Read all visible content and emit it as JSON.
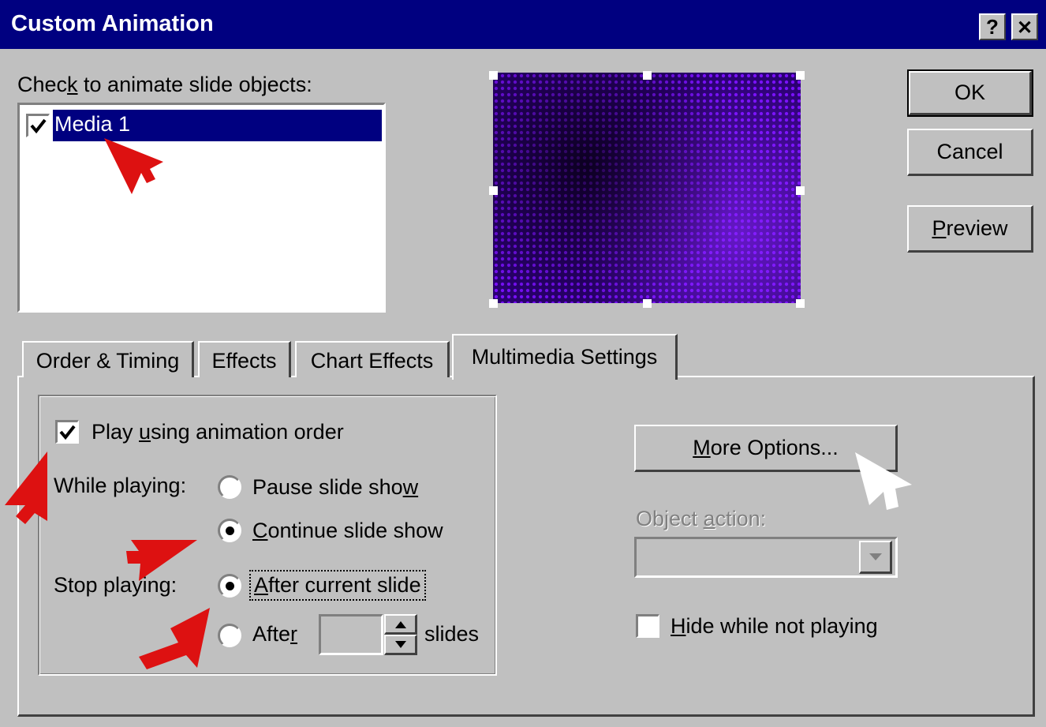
{
  "window": {
    "title": "Custom Animation",
    "help_label": "?",
    "close_label": "✕"
  },
  "objects": {
    "label_pre": "Chec",
    "label_accel": "k",
    "label_post": " to animate slide objects:",
    "items": [
      {
        "label": "Media 1",
        "checked": true
      }
    ]
  },
  "buttons": {
    "ok": "OK",
    "cancel": "Cancel",
    "preview_accel": "P",
    "preview_rest": "review"
  },
  "tabs": [
    {
      "label": "Order & Timing"
    },
    {
      "label": "Effects"
    },
    {
      "label": "Chart Effects"
    },
    {
      "label": "Multimedia Settings",
      "active": true
    }
  ],
  "multimedia": {
    "play_pre": "Play ",
    "play_accel": "u",
    "play_post": "sing animation order",
    "play_checked": true,
    "while_playing_label": "While playing:",
    "pause_pre": "Pause slide sho",
    "pause_accel": "w",
    "continue_accel": "C",
    "continue_rest": "ontinue slide show",
    "while_selected": "continue",
    "stop_playing_label": "Stop playing:",
    "after_current_accel": "A",
    "after_current_rest": "fter current slide",
    "after_n_pre": "Afte",
    "after_n_accel": "r",
    "after_n_value": "",
    "slides_label": "slides",
    "stop_selected": "after_current",
    "more_options_accel": "M",
    "more_options_rest": "ore Options...",
    "object_action_pre": "Object ",
    "object_action_accel": "a",
    "object_action_post": "ction:",
    "object_action_value": "",
    "hide_accel": "H",
    "hide_rest": "ide while not playing",
    "hide_checked": false
  },
  "colors": {
    "titlebar": "#000080",
    "selection": "#000080",
    "face": "#c0c0c0",
    "arrow_red": "#dd1111"
  },
  "icons": [
    "help-icon",
    "close-icon",
    "checkmark-icon",
    "spin-up-icon",
    "spin-down-icon",
    "dropdown-arrow-icon",
    "arrow-pointer-icon"
  ]
}
